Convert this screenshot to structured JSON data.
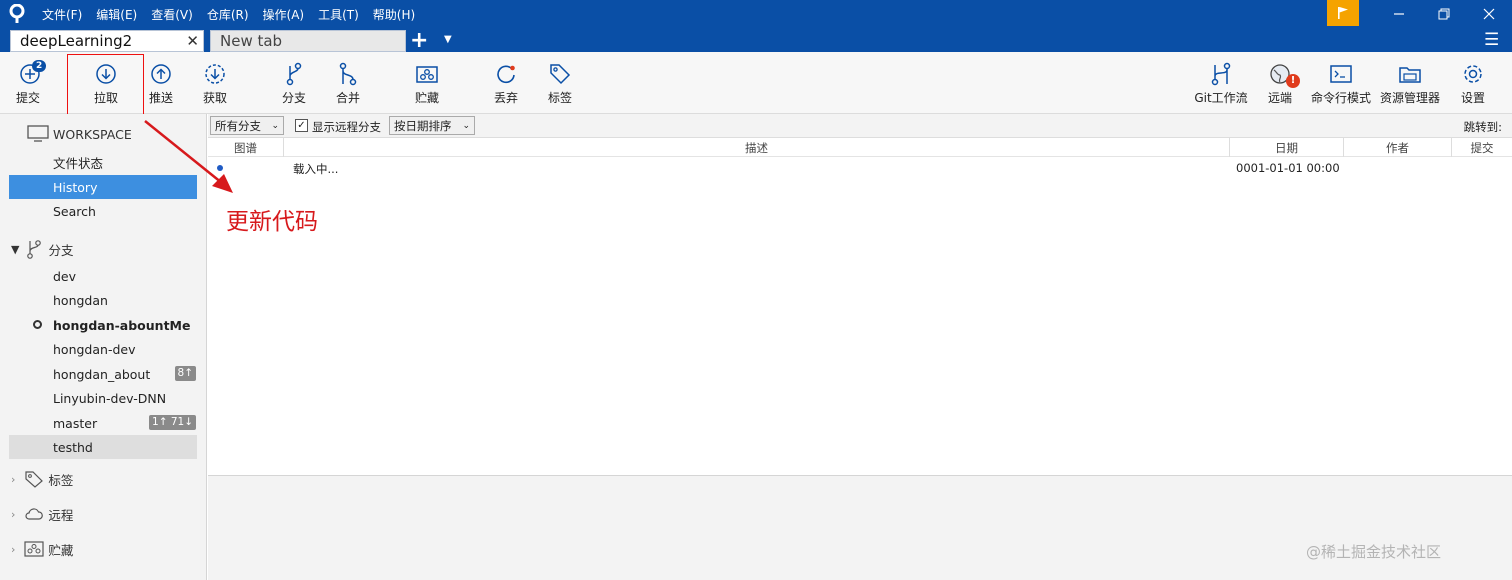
{
  "menu": [
    "文件(F)",
    "编辑(E)",
    "查看(V)",
    "仓库(R)",
    "操作(A)",
    "工具(T)",
    "帮助(H)"
  ],
  "tabs": {
    "active": "deepLearning2",
    "inactive": "New tab"
  },
  "toolbar": {
    "commit": {
      "label": "提交",
      "badge": "2"
    },
    "pull": "拉取",
    "push": "推送",
    "fetch": "获取",
    "branch": "分支",
    "merge": "合并",
    "stash": "贮藏",
    "discard": "丢弃",
    "tag": "标签",
    "gitflow": "Git工作流",
    "remote": "远端",
    "terminal": "命令行模式",
    "explorer": "资源管理器",
    "settings": "设置"
  },
  "sidebar": {
    "workspace": "WORKSPACE",
    "workspace_items": [
      "文件状态",
      "History",
      "Search"
    ],
    "branches_title": "分支",
    "branches": [
      {
        "name": "dev",
        "badge": ""
      },
      {
        "name": "hongdan",
        "badge": ""
      },
      {
        "name": "hongdan-abountMe",
        "badge": ""
      },
      {
        "name": "hongdan-dev",
        "badge": ""
      },
      {
        "name": "hongdan_about",
        "badge": "8↑"
      },
      {
        "name": "Linyubin-dev-DNN",
        "badge": ""
      },
      {
        "name": "master",
        "badge": "1↑ 71↓"
      },
      {
        "name": "testhd",
        "badge": ""
      }
    ],
    "tags_title": "标签",
    "remotes_title": "远程",
    "stashes_title": "贮藏"
  },
  "filterbar": {
    "branch_filter": "所有分支",
    "show_remote": "显示远程分支",
    "sort": "按日期排序",
    "jump_to": "跳转到:"
  },
  "columns": {
    "graph": "图谱",
    "desc": "描述",
    "date": "日期",
    "author": "作者",
    "commit": "提交"
  },
  "rows": [
    {
      "desc": "载入中...",
      "date": "0001-01-01 00:00"
    }
  ],
  "annotation": "更新代码",
  "watermark": "@稀土掘金技术社区",
  "colors": {
    "title_bar": "#0a4fa6",
    "active_item": "#3d8fe0",
    "annotation": "#d7191c",
    "flag": "#f5a300"
  }
}
